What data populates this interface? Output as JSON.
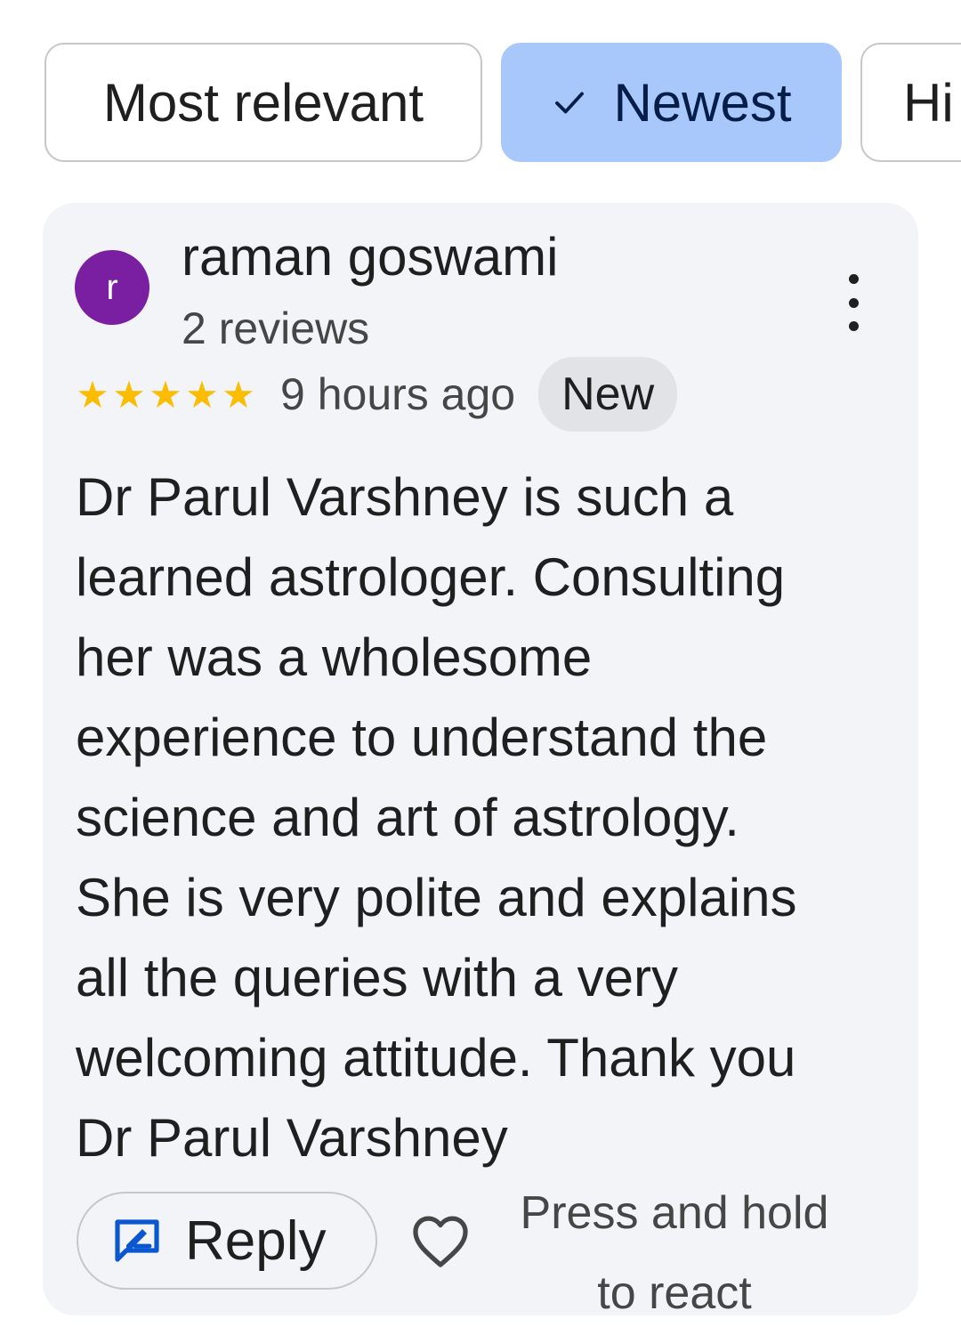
{
  "filters": {
    "chips": [
      {
        "label": "Most relevant",
        "selected": false
      },
      {
        "label": "Newest",
        "selected": true
      },
      {
        "label": "Hi",
        "selected": false
      }
    ]
  },
  "review": {
    "avatar_initial": "r",
    "avatar_color": "#7b1fa2",
    "reviewer_name": "raman goswami",
    "reviewer_reviews": "2 reviews",
    "rating": 5,
    "rating_stars": "★★★★★",
    "star_color": "#fbbc04",
    "time_ago": "9 hours ago",
    "badge": "New",
    "text_lines": [
      "Dr Parul Varshney is such a",
      "learned astrologer. Consulting",
      "her was a wholesome",
      "experience to understand the",
      "science and art of astrology.",
      "She is very polite and explains",
      "all the queries with a very",
      "welcoming attitude. Thank you",
      "Dr Parul Varshney"
    ],
    "actions": {
      "reply_label": "Reply",
      "reply_icon": "reply-edit-icon",
      "react_icon": "heart-outline-icon",
      "react_hint_lines": [
        "Press and hold",
        "to react"
      ]
    }
  },
  "colors": {
    "selected_chip_bg": "#a8c7fa",
    "reply_icon_color": "#0b57d0",
    "card_bg": "#f3f4f7"
  }
}
